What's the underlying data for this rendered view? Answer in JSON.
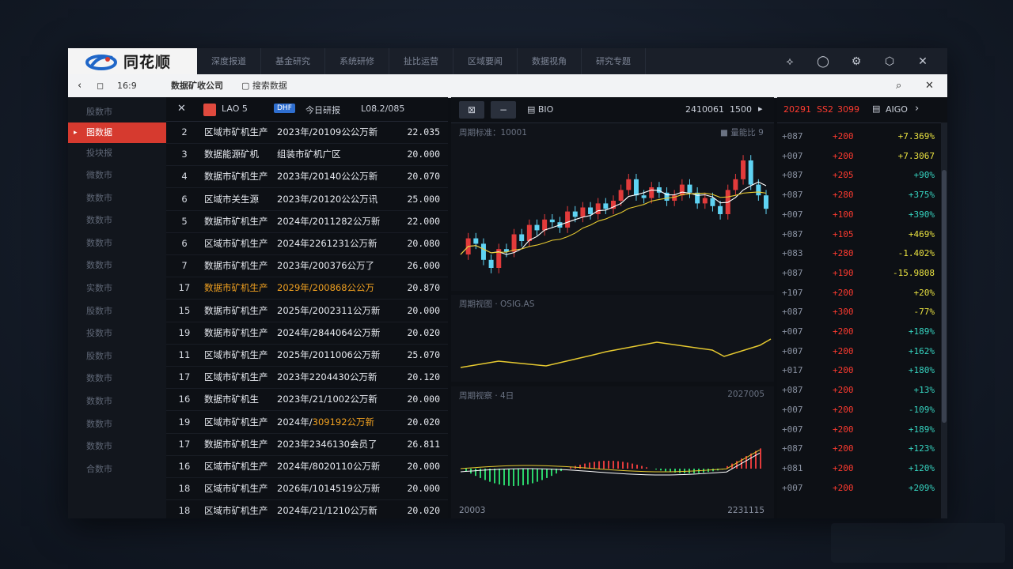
{
  "app": {
    "title": "同花顺"
  },
  "tabs": [
    "深度报道",
    "基金研究",
    "系统研修",
    "扯比运营",
    "区域要闻",
    "数据视角",
    "研究专题"
  ],
  "addr": {
    "count": "16:9",
    "page_title": "数据矿收公司",
    "search_label": "搜索数据"
  },
  "sidebar": {
    "items": [
      "股数市",
      "图数据",
      "投块报",
      "微数市",
      "数数市",
      "数数市",
      "数数市",
      "数数市",
      "实数市",
      "股数市",
      "投数市",
      "股数市",
      "数数市",
      "数数市",
      "数数市",
      "数数市",
      "合数市"
    ],
    "active_index": 1
  },
  "table": {
    "header": {
      "code": "LAO 5",
      "badge": "DHF",
      "name": "今日研报",
      "range": "L08.2/085"
    },
    "rows": [
      {
        "n": "2",
        "a": "区域市矿机生产",
        "b": "2023年/20109公公万新",
        "v": "22.035",
        "hl": false
      },
      {
        "n": "3",
        "a": "数据能源矿机",
        "b": "组装市矿机广区",
        "v": "20.000",
        "hl": false
      },
      {
        "n": "4",
        "a": "数据市矿机生产",
        "b": "2023年/20140公公万新",
        "v": "20.070",
        "hl": false
      },
      {
        "n": "6",
        "a": "区域市关生源",
        "b": "2023年/20120公公万讯",
        "v": "25.000",
        "hl": false
      },
      {
        "n": "5",
        "a": "数据市矿机生产",
        "b": "2024年/2011282公万新",
        "v": "22.000",
        "hl": false
      },
      {
        "n": "6",
        "a": "区域市矿机生产",
        "b": "2024年2261231公万新",
        "v": "20.080",
        "hl": false
      },
      {
        "n": "7",
        "a": "数据市矿机生产",
        "b": "2023年/200376公万了",
        "v": "26.000",
        "hl": false
      },
      {
        "n": "17",
        "a": "数据市矿机生产",
        "b": "2029年/200868公公万",
        "v": "20.870",
        "hl": true
      },
      {
        "n": "15",
        "a": "数据市矿机生产",
        "b": "2025年/2002311公万新",
        "v": "20.000",
        "hl": false
      },
      {
        "n": "19",
        "a": "数据市矿机生产",
        "b": "2024年/2844064公万新",
        "v": "20.020",
        "hl": false
      },
      {
        "n": "11",
        "a": "区域市矿机生产",
        "b": "2025年/2011006公万新",
        "v": "25.070",
        "hl": false
      },
      {
        "n": "17",
        "a": "区域市矿机生产",
        "b": "2023年2204430公万新",
        "v": "20.120",
        "hl": false
      },
      {
        "n": "16",
        "a": "数据市矿机生",
        "b": "2023年/21/1002公万新",
        "v": "20.000",
        "hl": false
      },
      {
        "n": "19",
        "a": "区域市矿机生产",
        "b": "2024年/",
        "b2": "309192公万新",
        "v": "20.020",
        "hl": false
      },
      {
        "n": "17",
        "a": "数据市矿机生产",
        "b": "2023年2346130会员了",
        "v": "26.811",
        "hl": false
      },
      {
        "n": "16",
        "a": "区域市矿机生产",
        "b": "2024年/8020110公万新",
        "v": "20.000",
        "hl": false
      },
      {
        "n": "18",
        "a": "区域市矿机生产",
        "b": "2026年/1014519公万新",
        "v": "20.000",
        "hl": false
      },
      {
        "n": "18",
        "a": "区域市矿机生产",
        "b": "2024年/21/1210公万新",
        "v": "20.020",
        "hl": false
      }
    ]
  },
  "chart_toolbar": {
    "period": "BIO",
    "date": "2410061",
    "volume": "1500"
  },
  "chart_panels": {
    "main_label": "周期标准：10001",
    "main_legend": "量能比 9",
    "mid_label": "周期视图 · OSIG.AS",
    "low_label": "周期视察 · 4日",
    "low_right": "2027005",
    "bottom_left": "20003",
    "bottom_right": "2231115"
  },
  "quotes": {
    "header": {
      "a": "20291",
      "b": "SS2",
      "c": "3099",
      "label": "AIGO"
    },
    "rows": [
      {
        "c1": "+087",
        "c2": "+200",
        "c3": "+7.369%",
        "color": "#e8e040"
      },
      {
        "c1": "+007",
        "c2": "+200",
        "c3": "+7.3067",
        "color": "#e8e040"
      },
      {
        "c1": "+087",
        "c2": "+205",
        "c3": "+90%",
        "color": "#36d3c0"
      },
      {
        "c1": "+087",
        "c2": "+280",
        "c3": "+375%",
        "color": "#36d3c0"
      },
      {
        "c1": "+007",
        "c2": "+100",
        "c3": "+390%",
        "color": "#36d3c0"
      },
      {
        "c1": "+087",
        "c2": "+105",
        "c3": "+469%",
        "color": "#e8e040"
      },
      {
        "c1": "+083",
        "c2": "+280",
        "c3": "-1.402%",
        "color": "#e8e040"
      },
      {
        "c1": "+087",
        "c2": "+190",
        "c3": "-15.9808",
        "color": "#e8e040"
      },
      {
        "c1": "+107",
        "c2": "+200",
        "c3": "+20%",
        "color": "#e8e040"
      },
      {
        "c1": "+087",
        "c2": "+300",
        "c3": "-77%",
        "color": "#e8e040"
      },
      {
        "c1": "+007",
        "c2": "+200",
        "c3": "+189%",
        "color": "#36d3c0"
      },
      {
        "c1": "+007",
        "c2": "+200",
        "c3": "+162%",
        "color": "#36d3c0"
      },
      {
        "c1": "+017",
        "c2": "+200",
        "c3": "+180%",
        "color": "#36d3c0"
      },
      {
        "c1": "+087",
        "c2": "+200",
        "c3": "+13%",
        "color": "#36d3c0"
      },
      {
        "c1": "+007",
        "c2": "+200",
        "c3": "-109%",
        "color": "#36d3c0"
      },
      {
        "c1": "+007",
        "c2": "+200",
        "c3": "+189%",
        "color": "#36d3c0"
      },
      {
        "c1": "+087",
        "c2": "+200",
        "c3": "+123%",
        "color": "#36d3c0"
      },
      {
        "c1": "+081",
        "c2": "+200",
        "c3": "+120%",
        "color": "#36d3c0"
      },
      {
        "c1": "+007",
        "c2": "+200",
        "c3": "+209%",
        "color": "#36d3c0"
      }
    ]
  },
  "price_series": [
    40,
    52,
    48,
    36,
    30,
    44,
    42,
    55,
    50,
    62,
    58,
    66,
    64,
    60,
    72,
    68,
    75,
    70,
    78,
    74,
    80,
    88,
    96,
    84,
    82,
    90,
    86,
    80,
    84,
    92,
    86,
    78,
    82,
    76,
    70,
    88,
    96,
    110,
    92,
    84,
    74
  ]
}
